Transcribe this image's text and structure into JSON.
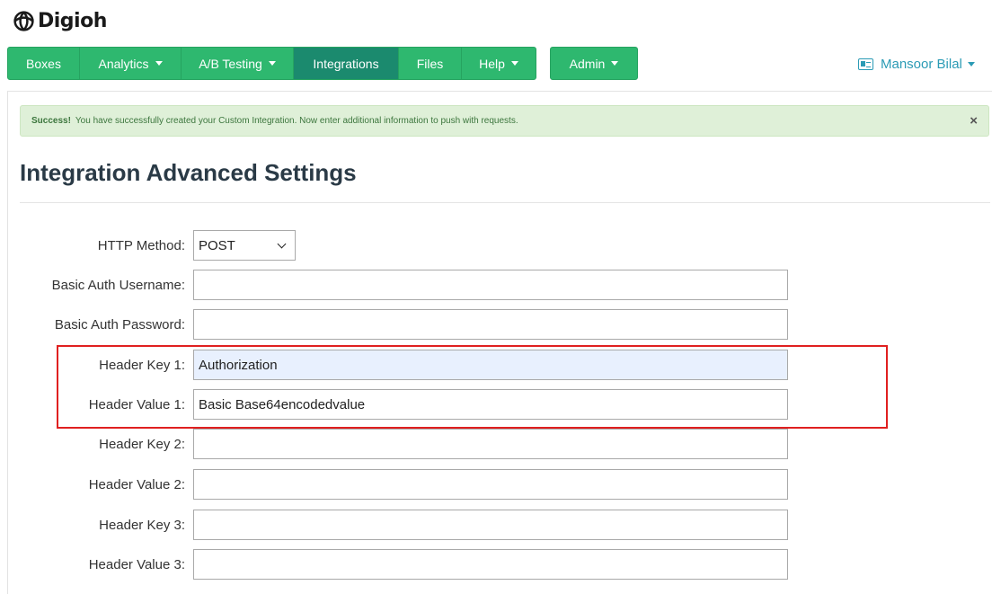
{
  "app": {
    "logo_text": "Digioh"
  },
  "nav": {
    "items": [
      {
        "label": "Boxes",
        "dropdown": false
      },
      {
        "label": "Analytics",
        "dropdown": true
      },
      {
        "label": "A/B Testing",
        "dropdown": true
      },
      {
        "label": "Integrations",
        "dropdown": false,
        "active": true
      },
      {
        "label": "Files",
        "dropdown": false
      },
      {
        "label": "Help",
        "dropdown": true
      }
    ],
    "admin": {
      "label": "Admin",
      "dropdown": true
    }
  },
  "user": {
    "name": "Mansoor Bilal"
  },
  "alert": {
    "strong": "Success!",
    "message": "You have successfully created your Custom Integration. Now enter additional information to push with requests.",
    "close": "×"
  },
  "page": {
    "title": "Integration Advanced Settings"
  },
  "form": {
    "http_method": {
      "label": "HTTP Method:",
      "value": "POST"
    },
    "fields": [
      {
        "label": "Basic Auth Username:",
        "value": ""
      },
      {
        "label": "Basic Auth Password:",
        "value": ""
      },
      {
        "label": "Header Key 1:",
        "value": "Authorization"
      },
      {
        "label": "Header Value 1:",
        "value": "Basic Base64encodedvalue"
      },
      {
        "label": "Header Key 2:",
        "value": ""
      },
      {
        "label": "Header Value 2:",
        "value": ""
      },
      {
        "label": "Header Key 3:",
        "value": ""
      },
      {
        "label": "Header Value 3:",
        "value": ""
      }
    ]
  },
  "colors": {
    "nav_green": "#2eb86f",
    "nav_active": "#1b8a6e",
    "user_link": "#2b9bb5",
    "alert_bg": "#dff0d8",
    "highlight_border": "#e02020"
  }
}
